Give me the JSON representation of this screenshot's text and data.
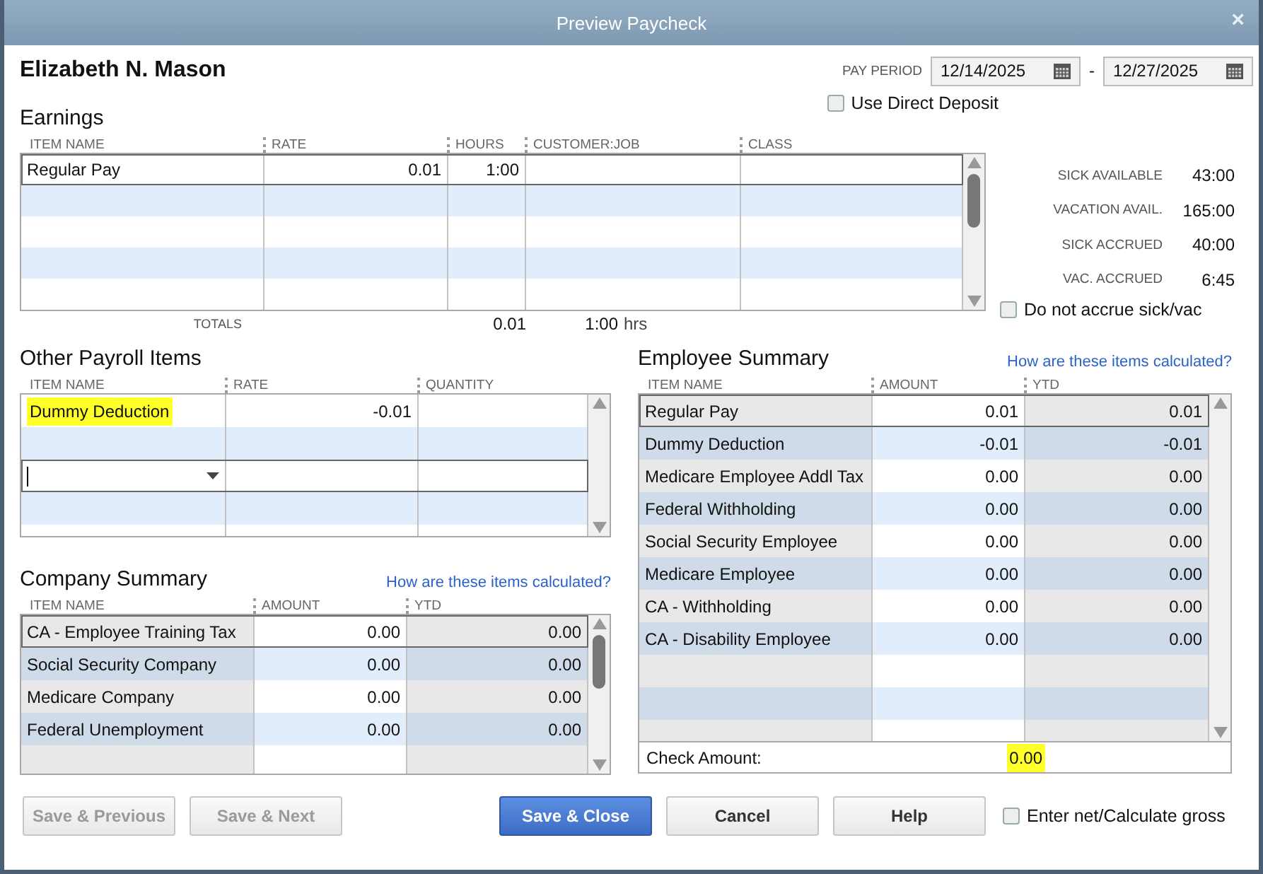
{
  "window": {
    "title": "Preview Paycheck",
    "close": "×"
  },
  "employee_name": "Elizabeth N. Mason",
  "pay_period": {
    "label": "PAY PERIOD",
    "start": "12/14/2025",
    "separator": "-",
    "end": "12/27/2025"
  },
  "direct_deposit": {
    "label": "Use Direct Deposit",
    "checked": false
  },
  "earnings": {
    "title": "Earnings",
    "columns": [
      "ITEM NAME",
      "RATE",
      "HOURS",
      "CUSTOMER:JOB",
      "CLASS"
    ],
    "rows": [
      {
        "item_name": "Regular Pay",
        "rate": "0.01",
        "hours": "1:00",
        "selected": true
      }
    ],
    "totals": {
      "label": "TOTALS",
      "rate": "0.01",
      "hours": "1:00",
      "unit": "hrs"
    }
  },
  "accruals": [
    {
      "label": "SICK AVAILABLE",
      "value": "43:00"
    },
    {
      "label": "VACATION AVAIL.",
      "value": "165:00"
    },
    {
      "label": "SICK ACCRUED",
      "value": "40:00"
    },
    {
      "label": "VAC. ACCRUED",
      "value": "6:45"
    }
  ],
  "do_not_accrue": {
    "label": "Do not accrue sick/vac",
    "checked": false
  },
  "other_payroll_items": {
    "title": "Other Payroll Items",
    "columns": [
      "ITEM NAME",
      "RATE",
      "QUANTITY"
    ],
    "rows": [
      {
        "item_name": "Dummy Deduction",
        "rate": "-0.01",
        "highlighted": true
      }
    ],
    "entry_row": {
      "focused": true
    }
  },
  "company_summary": {
    "title": "Company Summary",
    "link": "How are these items calculated?",
    "columns": [
      "ITEM NAME",
      "AMOUNT",
      "YTD"
    ],
    "rows": [
      {
        "item_name": "CA - Employee Training Tax",
        "amount": "0.00",
        "ytd": "0.00",
        "selected": true
      },
      {
        "item_name": "Social Security Company",
        "amount": "0.00",
        "ytd": "0.00",
        "selected": false
      },
      {
        "item_name": "Medicare Company",
        "amount": "0.00",
        "ytd": "0.00",
        "selected": false
      },
      {
        "item_name": "Federal Unemployment",
        "amount": "0.00",
        "ytd": "0.00",
        "selected": false
      }
    ]
  },
  "employee_summary": {
    "title": "Employee Summary",
    "link": "How are these items calculated?",
    "columns": [
      "ITEM NAME",
      "AMOUNT",
      "YTD"
    ],
    "rows": [
      {
        "item_name": "Regular Pay",
        "amount": "0.01",
        "ytd": "0.01",
        "selected": true
      },
      {
        "item_name": "Dummy Deduction",
        "amount": "-0.01",
        "ytd": "-0.01",
        "selected": false
      },
      {
        "item_name": "Medicare Employee Addl Tax",
        "amount": "0.00",
        "ytd": "0.00",
        "selected": false
      },
      {
        "item_name": "Federal Withholding",
        "amount": "0.00",
        "ytd": "0.00",
        "selected": false
      },
      {
        "item_name": "Social Security Employee",
        "amount": "0.00",
        "ytd": "0.00",
        "selected": false
      },
      {
        "item_name": "Medicare Employee",
        "amount": "0.00",
        "ytd": "0.00",
        "selected": false
      },
      {
        "item_name": "CA - Withholding",
        "amount": "0.00",
        "ytd": "0.00",
        "selected": false
      },
      {
        "item_name": "CA - Disability Employee",
        "amount": "0.00",
        "ytd": "0.00",
        "selected": false
      }
    ],
    "check_amount": {
      "label": "Check Amount:",
      "value": "0.00",
      "highlighted": true
    }
  },
  "buttons": [
    {
      "label": "Save & Previous",
      "kind": "secondary",
      "disabled": true
    },
    {
      "label": "Save & Next",
      "kind": "secondary",
      "disabled": true
    },
    {
      "label": "Save & Close",
      "kind": "primary",
      "disabled": false
    },
    {
      "label": "Cancel",
      "kind": "default",
      "disabled": false
    },
    {
      "label": "Help",
      "kind": "default",
      "disabled": false
    }
  ],
  "enter_net": {
    "label": "Enter net/Calculate gross",
    "checked": false
  }
}
